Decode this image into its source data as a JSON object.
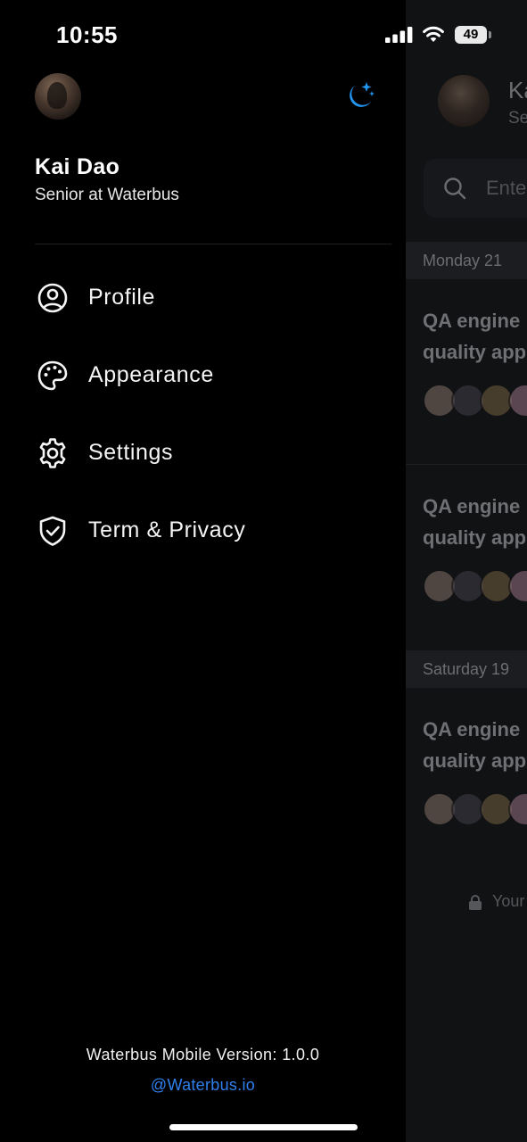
{
  "status_bar": {
    "time": "10:55",
    "battery": "49"
  },
  "drawer": {
    "user": {
      "name": "Kai Dao",
      "role": "Senior at Waterbus"
    },
    "menu": [
      {
        "label": "Profile",
        "icon": "user-circle-icon"
      },
      {
        "label": "Appearance",
        "icon": "palette-icon"
      },
      {
        "label": "Settings",
        "icon": "gear-icon"
      },
      {
        "label": "Term & Privacy",
        "icon": "shield-check-icon"
      }
    ],
    "footer": {
      "version": "Waterbus Mobile Version: 1.0.0",
      "link": "@Waterbus.io"
    }
  },
  "background": {
    "header_name": "Ka",
    "header_role": "Se",
    "search_placeholder": "Ente",
    "sections": [
      {
        "date": "Monday 21"
      },
      {
        "date": "Saturday 19"
      }
    ],
    "card_line1": "QA engine",
    "card_line2": "quality app",
    "footer_text": "Your"
  },
  "colors": {
    "accent": "#2f80ed",
    "drawer_bg": "#000000",
    "screen_bg": "#111214",
    "theme_icon": "#2196f3"
  }
}
